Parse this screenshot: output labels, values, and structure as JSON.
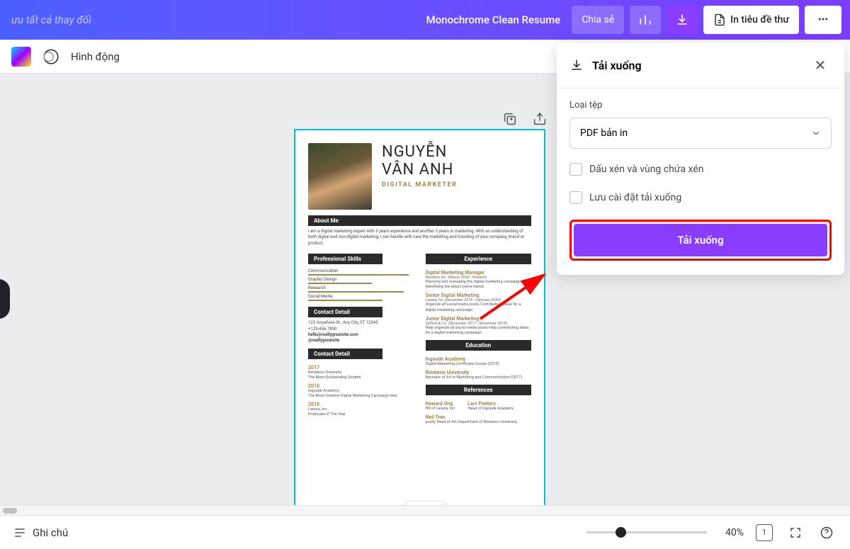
{
  "header": {
    "save_status": "ưu tất cả thay đổi",
    "title": "Monochrome Clean Resume",
    "share": "Chia sẻ",
    "print": "In tiêu đề thư"
  },
  "toolbar": {
    "animation": "Hình động"
  },
  "panel": {
    "title": "Tải xuống",
    "filetype_label": "Loại tệp",
    "filetype_value": "PDF bản in",
    "crop_checkbox": "Dấu xén và vùng chứa xén",
    "save_settings": "Lưu cài đặt tải xuống",
    "download_button": "Tải xuống"
  },
  "footer": {
    "notes": "Ghi chú",
    "zoom": "40%",
    "page": "1"
  },
  "resume": {
    "name_line1": "NGUYỄN",
    "name_line2": "VÂN ANH",
    "role": "DIGITAL MARKETER",
    "about_h": "About Me",
    "about": "I am a digital marketing expert with 5 years experience and another 5 years in marketing. With an understanding of both digital and non-digital marketing, I can handle with care the marketing and branding of your company, brand or product.",
    "skills_h": "Professional Skills",
    "skills": [
      "Communication",
      "Graphic Design",
      "Research",
      "Social Media"
    ],
    "contact_h": "Contact Detail",
    "contact": [
      "123 Anywhere St., Any City, ST 12345",
      "+123-456-7890",
      "hello@reallygreatsite.com",
      "@reallygreatsite"
    ],
    "contact2_h": "Contact Detail",
    "awards": [
      {
        "y": "2017",
        "o": "Rimberio University",
        "d": "The Most Outstanding Student"
      },
      {
        "y": "2018",
        "o": "Ingoude Academy",
        "d": "The Most Creative Digital Marketing Campaign Idea"
      },
      {
        "y": "2019",
        "o": "Larana, Inc",
        "d": "Employee of The Year"
      }
    ],
    "exp_h": "Experience",
    "exp": [
      {
        "t": "Digital Marketing Manager",
        "m": "Wardlow Inc. (March 2020 - Present)",
        "d": "Planning and managing the digital marketing campaigns Identifying the latest online trends"
      },
      {
        "t": "Senior Digital Marketing",
        "m": "Larana, Inc (December 2018 - February 2020)",
        "d": "Organize all social media posts Contributing ideas for a digital marketing campaign"
      },
      {
        "t": "Junior Digital Marketing",
        "m": "Salford & Co. (December 2017 - November 2018)",
        "d": "Help organize all social media posts Help contributing ideas for a digital marketing campaign"
      }
    ],
    "edu_h": "Education",
    "edu": [
      {
        "t": "Ingoude Academy",
        "d": "Digital Marketing Certificate Course (2018)"
      },
      {
        "t": "Rimberio University",
        "d": "Bachelor of Art in Marketing and Communication (2017)"
      }
    ],
    "ref_h": "References",
    "ref": [
      {
        "n": "Howard Ong",
        "r": "HR of Larana, Inc"
      },
      {
        "n": "Lars Peeters",
        "r": "Head of Ingoude Academy"
      },
      {
        "n": "Neil Tran",
        "r": "aculty Head of Art Department of Rimberio University"
      }
    ]
  }
}
